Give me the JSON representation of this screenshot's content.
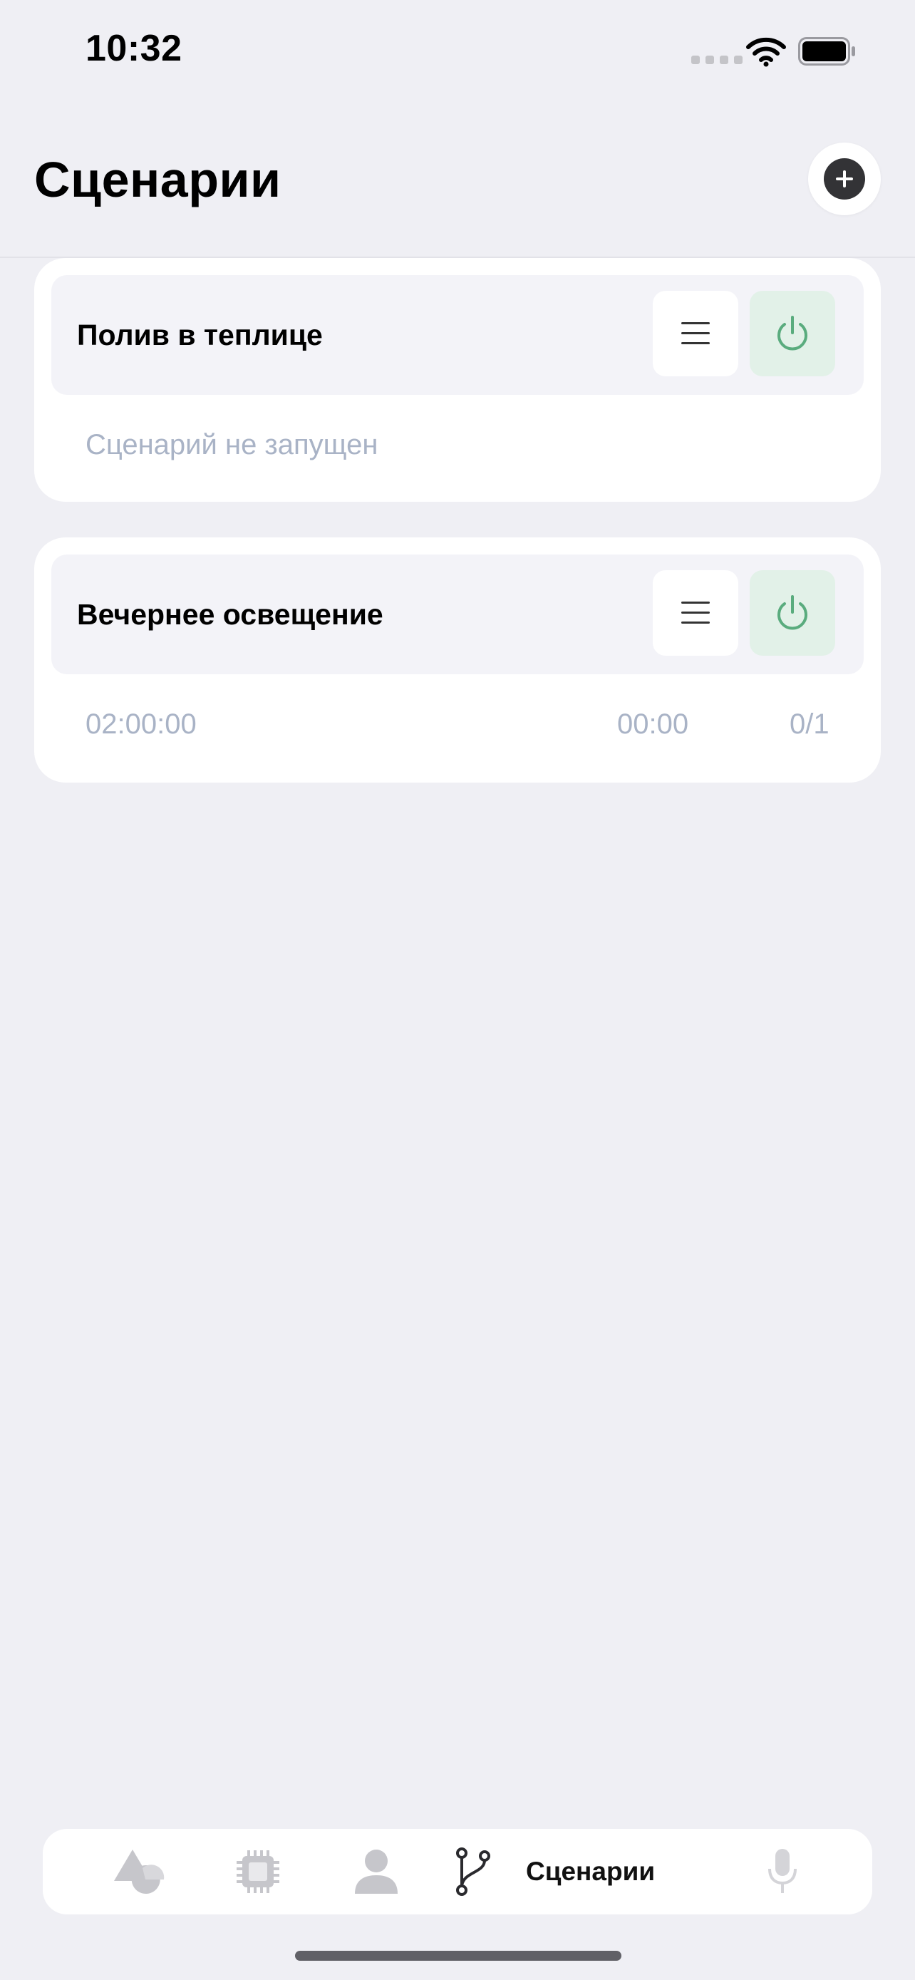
{
  "status_bar": {
    "time": "10:32"
  },
  "header": {
    "title": "Сценарии"
  },
  "scenarios": [
    {
      "name": "Полив в теплице",
      "status": "Сценарий не запущен"
    },
    {
      "name": "Вечернее освещение",
      "duration": "02:00:00",
      "elapsed": "00:00",
      "progress": "0/1"
    }
  ],
  "tabbar": {
    "tabs": [
      {
        "icon": "shapes-icon",
        "active": false
      },
      {
        "icon": "chip-icon",
        "active": false
      },
      {
        "icon": "person-icon",
        "active": false
      },
      {
        "icon": "branch-icon",
        "label": "Сценарии",
        "active": true
      },
      {
        "icon": "microphone-icon",
        "active": false
      }
    ]
  },
  "colors": {
    "accent_green": "#5aac7e",
    "muted_text": "#a9b3c6",
    "background": "#efeff4"
  }
}
